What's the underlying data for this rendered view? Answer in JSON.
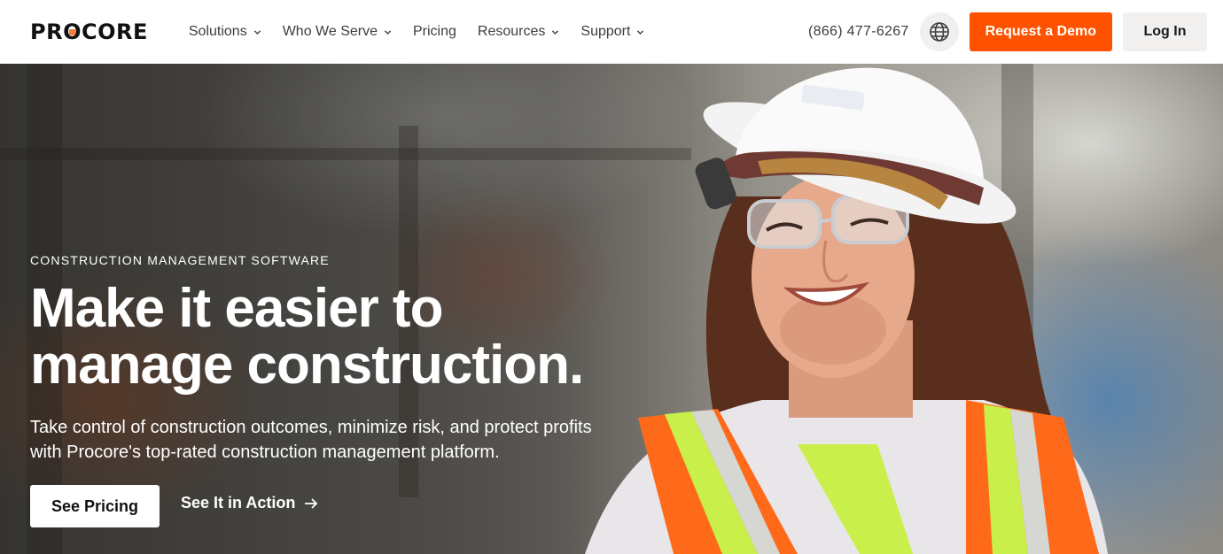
{
  "brand": {
    "logo_text": "PROCORE",
    "accent_color": "#ff5200",
    "logo_dot_color": "#f47e42"
  },
  "nav": {
    "items": [
      {
        "label": "Solutions",
        "has_dropdown": true
      },
      {
        "label": "Who We Serve",
        "has_dropdown": true
      },
      {
        "label": "Pricing",
        "has_dropdown": false
      },
      {
        "label": "Resources",
        "has_dropdown": true
      },
      {
        "label": "Support",
        "has_dropdown": true
      }
    ]
  },
  "header": {
    "phone": "(866) 477-6267",
    "globe_icon": "globe-icon",
    "demo_label": "Request a Demo",
    "login_label": "Log In"
  },
  "hero": {
    "eyebrow": "CONSTRUCTION MANAGEMENT SOFTWARE",
    "headline": "Make it easier to manage construction.",
    "subtext": "Take control of construction outcomes, minimize risk, and protect profits with Procore's top-rated construction management platform.",
    "primary_cta": "See Pricing",
    "secondary_cta": "See It in Action",
    "secondary_icon": "arrow-right-icon"
  }
}
